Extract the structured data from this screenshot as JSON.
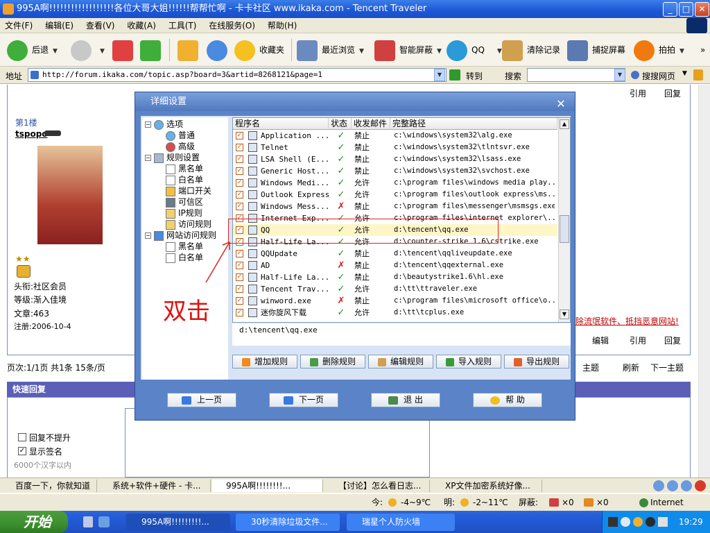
{
  "window": {
    "title": "995A啊!!!!!!!!!!!!!!!!!!各位大哥大姐!!!!!!帮帮忙啊 - 卡卡社区 www.ikaka.com - Tencent Traveler",
    "minimize": "_",
    "maximize": "□",
    "close": "✕"
  },
  "menu": [
    "文件(F)",
    "编辑(E)",
    "查看(V)",
    "收藏(A)",
    "工具(T)",
    "在线服务(O)",
    "帮助(H)"
  ],
  "toolbar": {
    "back": "后退",
    "favorites": "收藏夹",
    "recent": "最近浏览",
    "block": "智能屏蔽",
    "qq": "QQ",
    "clear": "清除记录",
    "capture": "捕捉屏幕",
    "paipai": "拍拍",
    "more": "»"
  },
  "address": {
    "label": "地址",
    "url": "http://forum.ikaka.com/topic.asp?board=3&artid=8268121&page=1",
    "go": "转到",
    "search_label": "搜索",
    "search_value": "",
    "search_web": "搜搜网页"
  },
  "forum": {
    "floor": "第1楼",
    "user": "tspopo",
    "title_label": "头衔:社区会员",
    "level_label": "等级:渐入佳境",
    "posts_label": "文章:463",
    "reg_label": "注册:2006-10-4",
    "quote": "引用",
    "reply": "回复",
    "edit": "编辑",
    "red_link": "除流氓软件、抵挡恶意网站!",
    "pager": "页次:1/1页 共1条 15条/页",
    "prev_topic": "主题",
    "refresh": "刷新",
    "next_topic": "下一主题",
    "quick_reply": "快速回复",
    "opt_noraise": "回复不提升",
    "opt_sign": "显示签名",
    "limit": "6000个汉字以内"
  },
  "dialog": {
    "title": "详细设置",
    "close": "✕",
    "annotation": "双击",
    "tree": [
      {
        "label": "选项",
        "level": 0,
        "expander": "−"
      },
      {
        "label": "普通",
        "level": 1
      },
      {
        "label": "高级",
        "level": 1
      },
      {
        "label": "规则设置",
        "level": 0,
        "expander": "−"
      },
      {
        "label": "黑名单",
        "level": 1
      },
      {
        "label": "白名单",
        "level": 1
      },
      {
        "label": "端口开关",
        "level": 1
      },
      {
        "label": "可信区",
        "level": 1
      },
      {
        "label": "IP规则",
        "level": 1
      },
      {
        "label": "访问规则",
        "level": 1
      },
      {
        "label": "网站访问规则",
        "level": 0,
        "expander": "−"
      },
      {
        "label": "黑名单",
        "level": 1
      },
      {
        "label": "白名单",
        "level": 1
      }
    ],
    "columns": [
      "程序名",
      "状态",
      "收发邮件",
      "完整路径"
    ],
    "rows": [
      {
        "name": "Application ...",
        "status": "ok",
        "mail": "禁止",
        "path": "c:\\windows\\system32\\alg.exe"
      },
      {
        "name": "Telnet",
        "status": "ok",
        "mail": "禁止",
        "path": "c:\\windows\\system32\\tlntsvr.exe"
      },
      {
        "name": "LSA Shell (E...",
        "status": "ok",
        "mail": "禁止",
        "path": "c:\\windows\\system32\\lsass.exe"
      },
      {
        "name": "Generic Host...",
        "status": "ok",
        "mail": "禁止",
        "path": "c:\\windows\\system32\\svchost.exe"
      },
      {
        "name": "Windows Medi...",
        "status": "ok",
        "mail": "允许",
        "path": "c:\\program files\\windows media play..."
      },
      {
        "name": "Outlook Express",
        "status": "ok",
        "mail": "允许",
        "path": "c:\\program files\\outlook express\\ms..."
      },
      {
        "name": "Windows Mess...",
        "status": "no",
        "mail": "禁止",
        "path": "c:\\program files\\messenger\\msmsgs.exe"
      },
      {
        "name": "Internet Exp...",
        "status": "ok",
        "mail": "允许",
        "path": "c:\\program files\\internet explorer\\..."
      },
      {
        "name": "QQ",
        "status": "ok",
        "mail": "允许",
        "path": "d:\\tencent\\qq.exe",
        "selected": true
      },
      {
        "name": "Half-Life La...",
        "status": "ok",
        "mail": "允许",
        "path": "d:\\counter-strike 1.6\\cstrike.exe"
      },
      {
        "name": "QQUpdate",
        "status": "ok",
        "mail": "禁止",
        "path": "d:\\tencent\\qqliveupdate.exe"
      },
      {
        "name": "AD",
        "status": "no",
        "mail": "禁止",
        "path": "d:\\tencent\\qqexternal.exe"
      },
      {
        "name": "Half-Life La...",
        "status": "ok",
        "mail": "禁止",
        "path": "d:\\beautystrike1.6\\hl.exe"
      },
      {
        "name": "Tencent Trav...",
        "status": "ok",
        "mail": "允许",
        "path": "d:\\tt\\ttraveler.exe"
      },
      {
        "name": "winword.exe",
        "status": "no",
        "mail": "禁止",
        "path": "c:\\program files\\microsoft office\\o..."
      },
      {
        "name": "迷你旋风下载",
        "status": "ok",
        "mail": "允许",
        "path": "d:\\tt\\tcplus.exe"
      }
    ],
    "selected_path": "d:\\tencent\\qq.exe",
    "rule_buttons": [
      "增加规则",
      "删除规则",
      "编辑规则",
      "导入规则",
      "导出规则"
    ],
    "nav_buttons": [
      "上一页",
      "下一页",
      "退 出",
      "帮 助"
    ],
    "check_mark": "✓",
    "ok_mark": "✓",
    "no_mark": "✗"
  },
  "tabs": [
    "百度一下，你就知道",
    "系统+软件+硬件 - 卡...",
    "995A啊!!!!!!!!...",
    "【讨论】怎么看日志...",
    "XP文件加密系统好像..."
  ],
  "status": {
    "today": "今:",
    "today_temp": "-4~9℃",
    "tomorrow": "明:",
    "tomorrow_temp": "-2~11℃",
    "block_label": "屏蔽:",
    "block1": "×0",
    "block2": "×0",
    "zone": "Internet"
  },
  "taskbar": {
    "start": "开始",
    "tasks": [
      "995A啊!!!!!!!!!...",
      "30秒清除垃圾文件...",
      "瑞星个人防火墙"
    ],
    "clock": "19:29"
  }
}
